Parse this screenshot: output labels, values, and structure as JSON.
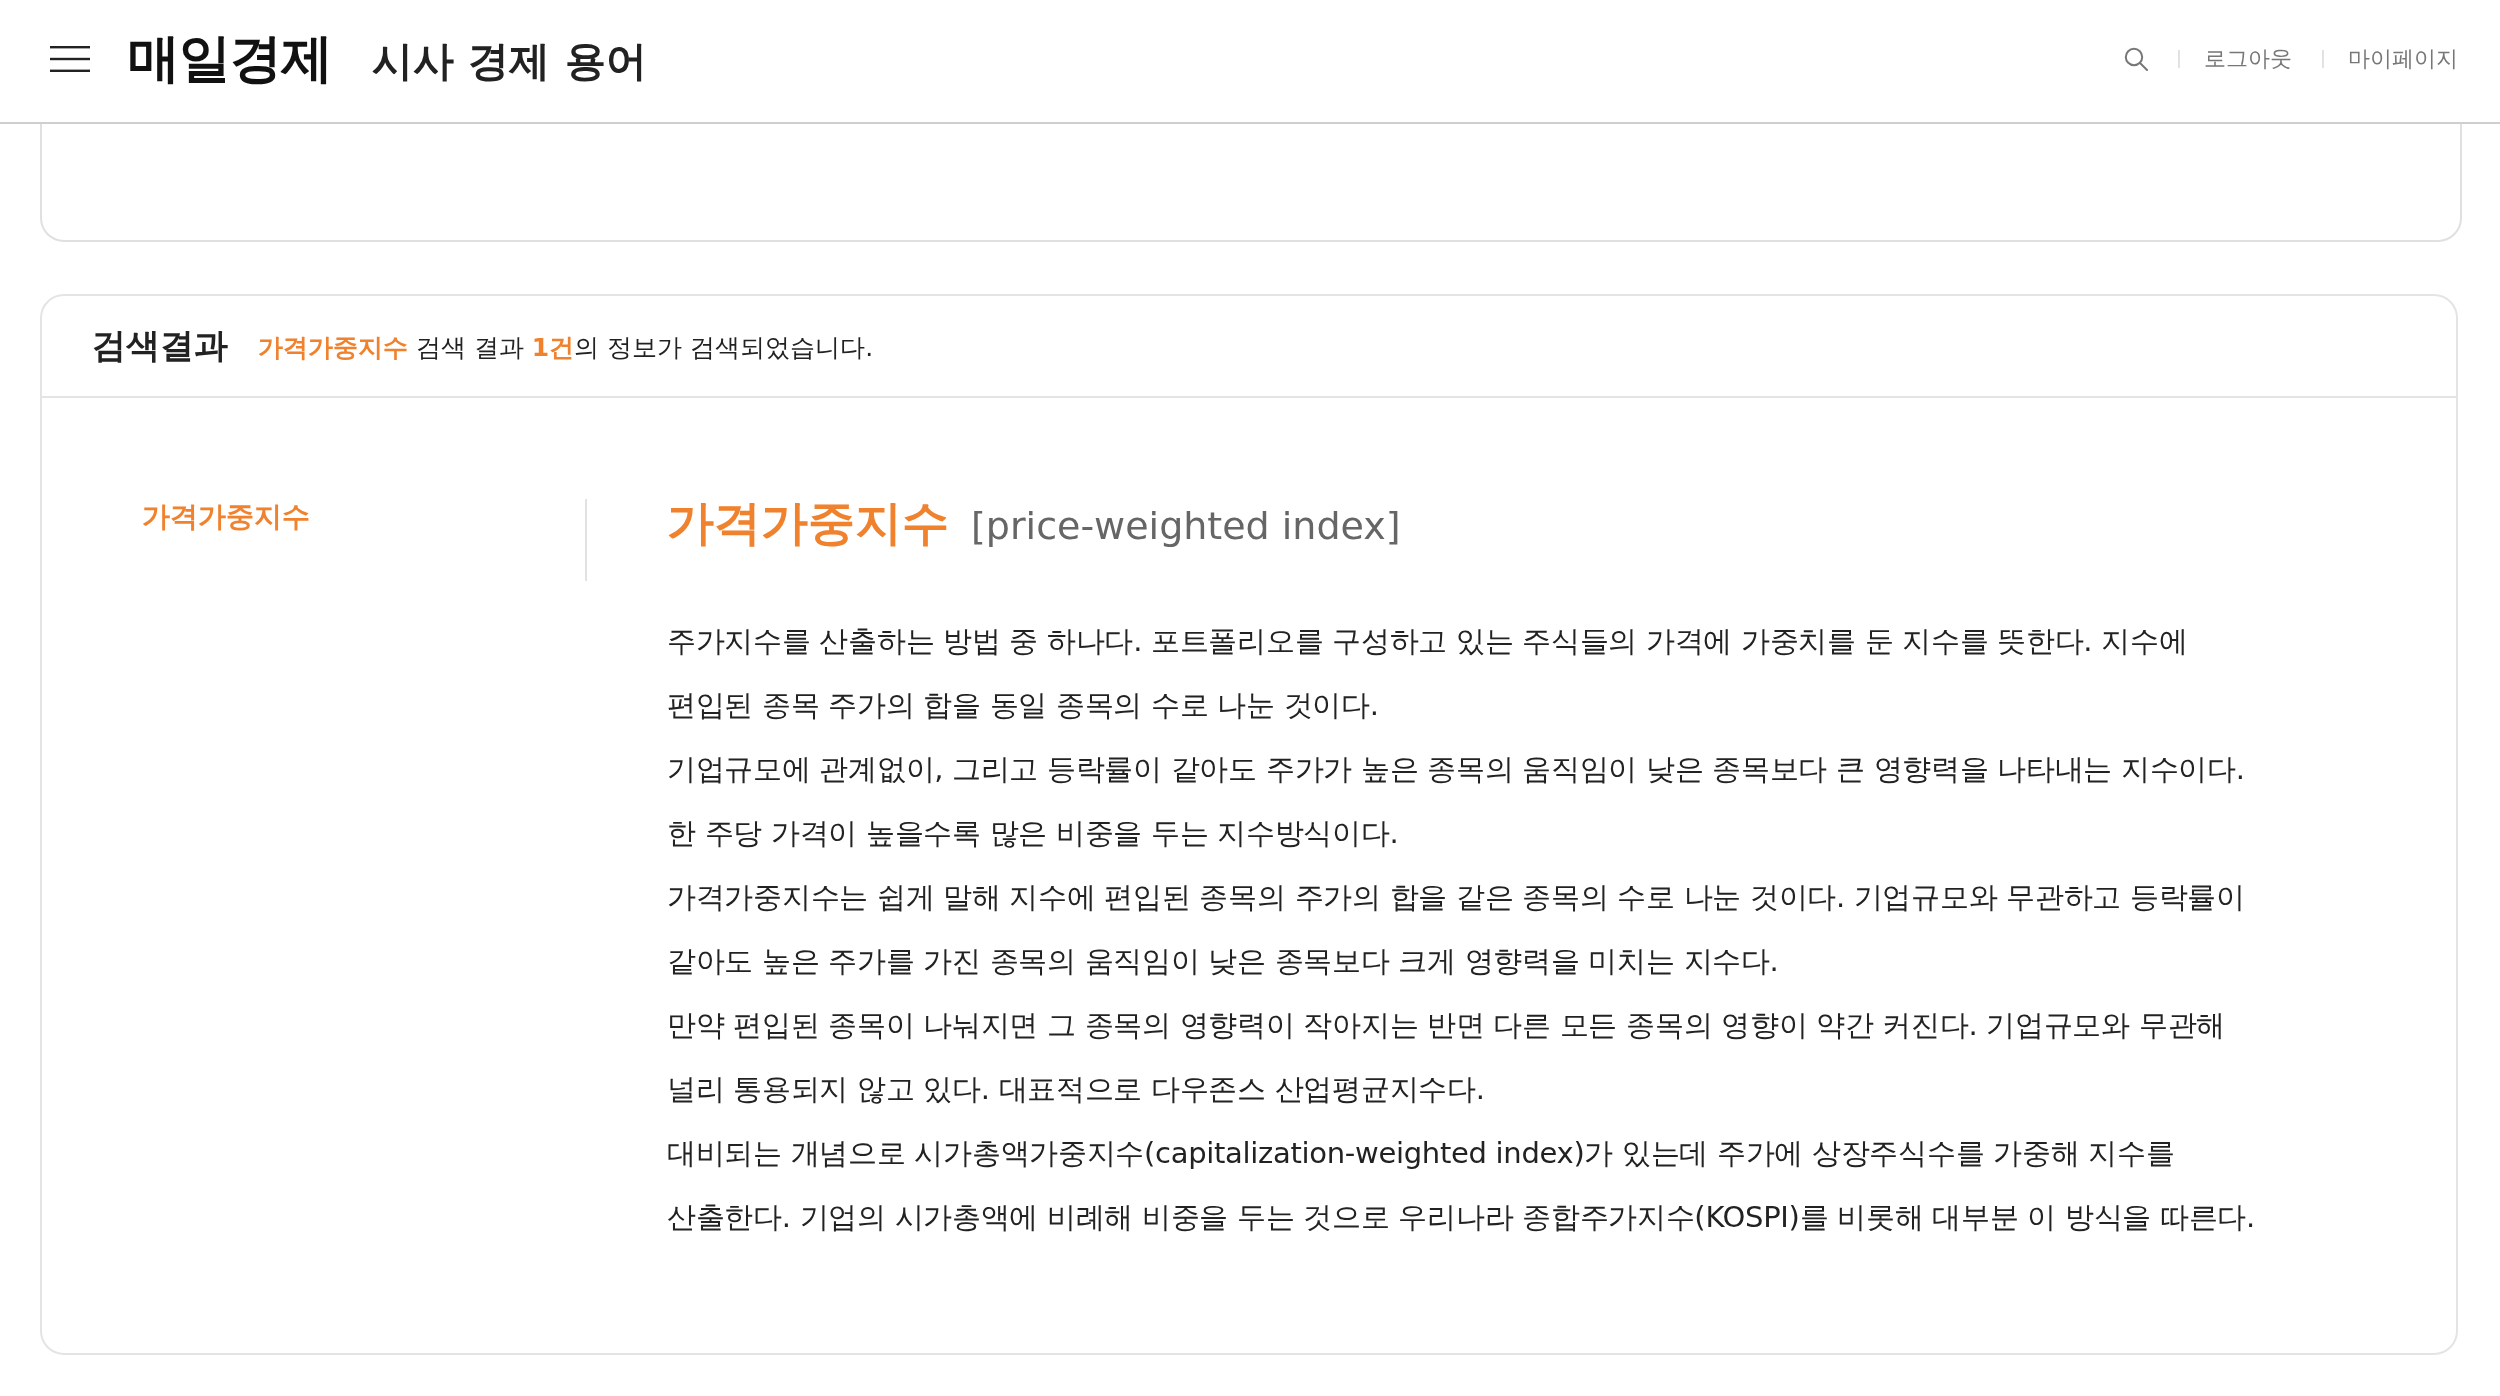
{
  "header": {
    "logo": "매일경제",
    "section_title": "시사 경제 용어",
    "links": [
      {
        "label": "로그아웃"
      },
      {
        "label": "마이페이지"
      }
    ]
  },
  "search_result": {
    "heading": "검색결과",
    "summary": "**가격가중지수** 검색 결과 **1건**의 정보가 검색되었습니다."
  },
  "term_list": [
    {
      "label": "가격가중지수",
      "selected": true
    }
  ],
  "entry": {
    "term": "가격가중지수",
    "english": "[price-weighted index]",
    "paragraphs": [
      "주가지수를 산출하는 방법 중 하나다. 포트폴리오를 구성하고 있는 주식들의 가격에 가중치를 둔 지수를 뜻한다. 지수에 편입된 종목 주가의 합을 동일 종목의 수로 나눈 것이다.",
      "기업규모에 관계없이, 그리고 등락률이 같아도 주가가 높은 종목의 움직임이 낮은 종목보다 큰 영향력을 나타내는 지수이다. 한 주당 가격이 높을수록 많은 비중을 두는 지수방식이다.",
      "가격가중지수는 쉽게 말해 지수에 편입된 종목의 주가의 합을 같은 종목의 수로 나눈 것이다. 기업규모와 무관하고 등락률이 같아도 높은 주가를 가진 종목의 움직임이 낮은 종목보다 크게 영향력을 미치는 지수다.",
      "만약 편입된 종목이 나눠지면 그 종목의 영향력이 작아지는 반면 다른 모든 종목의 영향이 약간 커진다. 기업규모와 무관해 널리 통용되지 않고 있다. 대표적으로 다우존스 산업평균지수다.",
      "대비되는 개념으로 시가총액가중지수(capitalization-weighted index)가 있는데 주가에 상장주식수를 가중해 지수를 산출한다. 기업의 시가총액에 비례해 비중을 두는 것으로 우리나라 종합주가지수(KOSPI)를 비롯해 대부분 이 방식을 따른다."
    ]
  }
}
